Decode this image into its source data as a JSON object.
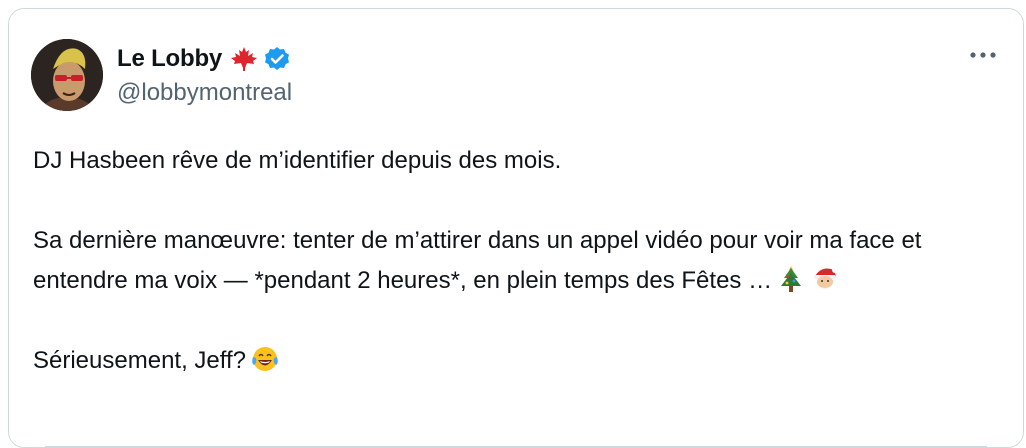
{
  "tweet": {
    "author": {
      "display_name": "Le Lobby",
      "handle": "@lobbymontreal",
      "verified": true,
      "flag_icon": "maple-leaf-icon",
      "badge_color": "#1d9bf0",
      "flag_color": "#e0242e"
    },
    "more_icon": "more-horizontal-icon",
    "paragraphs": {
      "p1": "DJ Hasbeen rêve de m’identifier depuis des mois.",
      "p2": "Sa dernière manœuvre: tenter de m’attirer dans un appel vidéo pour voir ma face et entendre ma voix — *pendant 2 heures*, en plein temps des Fêtes …",
      "p3": "Sérieusement, Jeff?"
    },
    "emojis": {
      "p2": [
        "christmas-tree-icon",
        "santa-icon"
      ],
      "p3": [
        "laughing-tears-icon"
      ]
    }
  }
}
